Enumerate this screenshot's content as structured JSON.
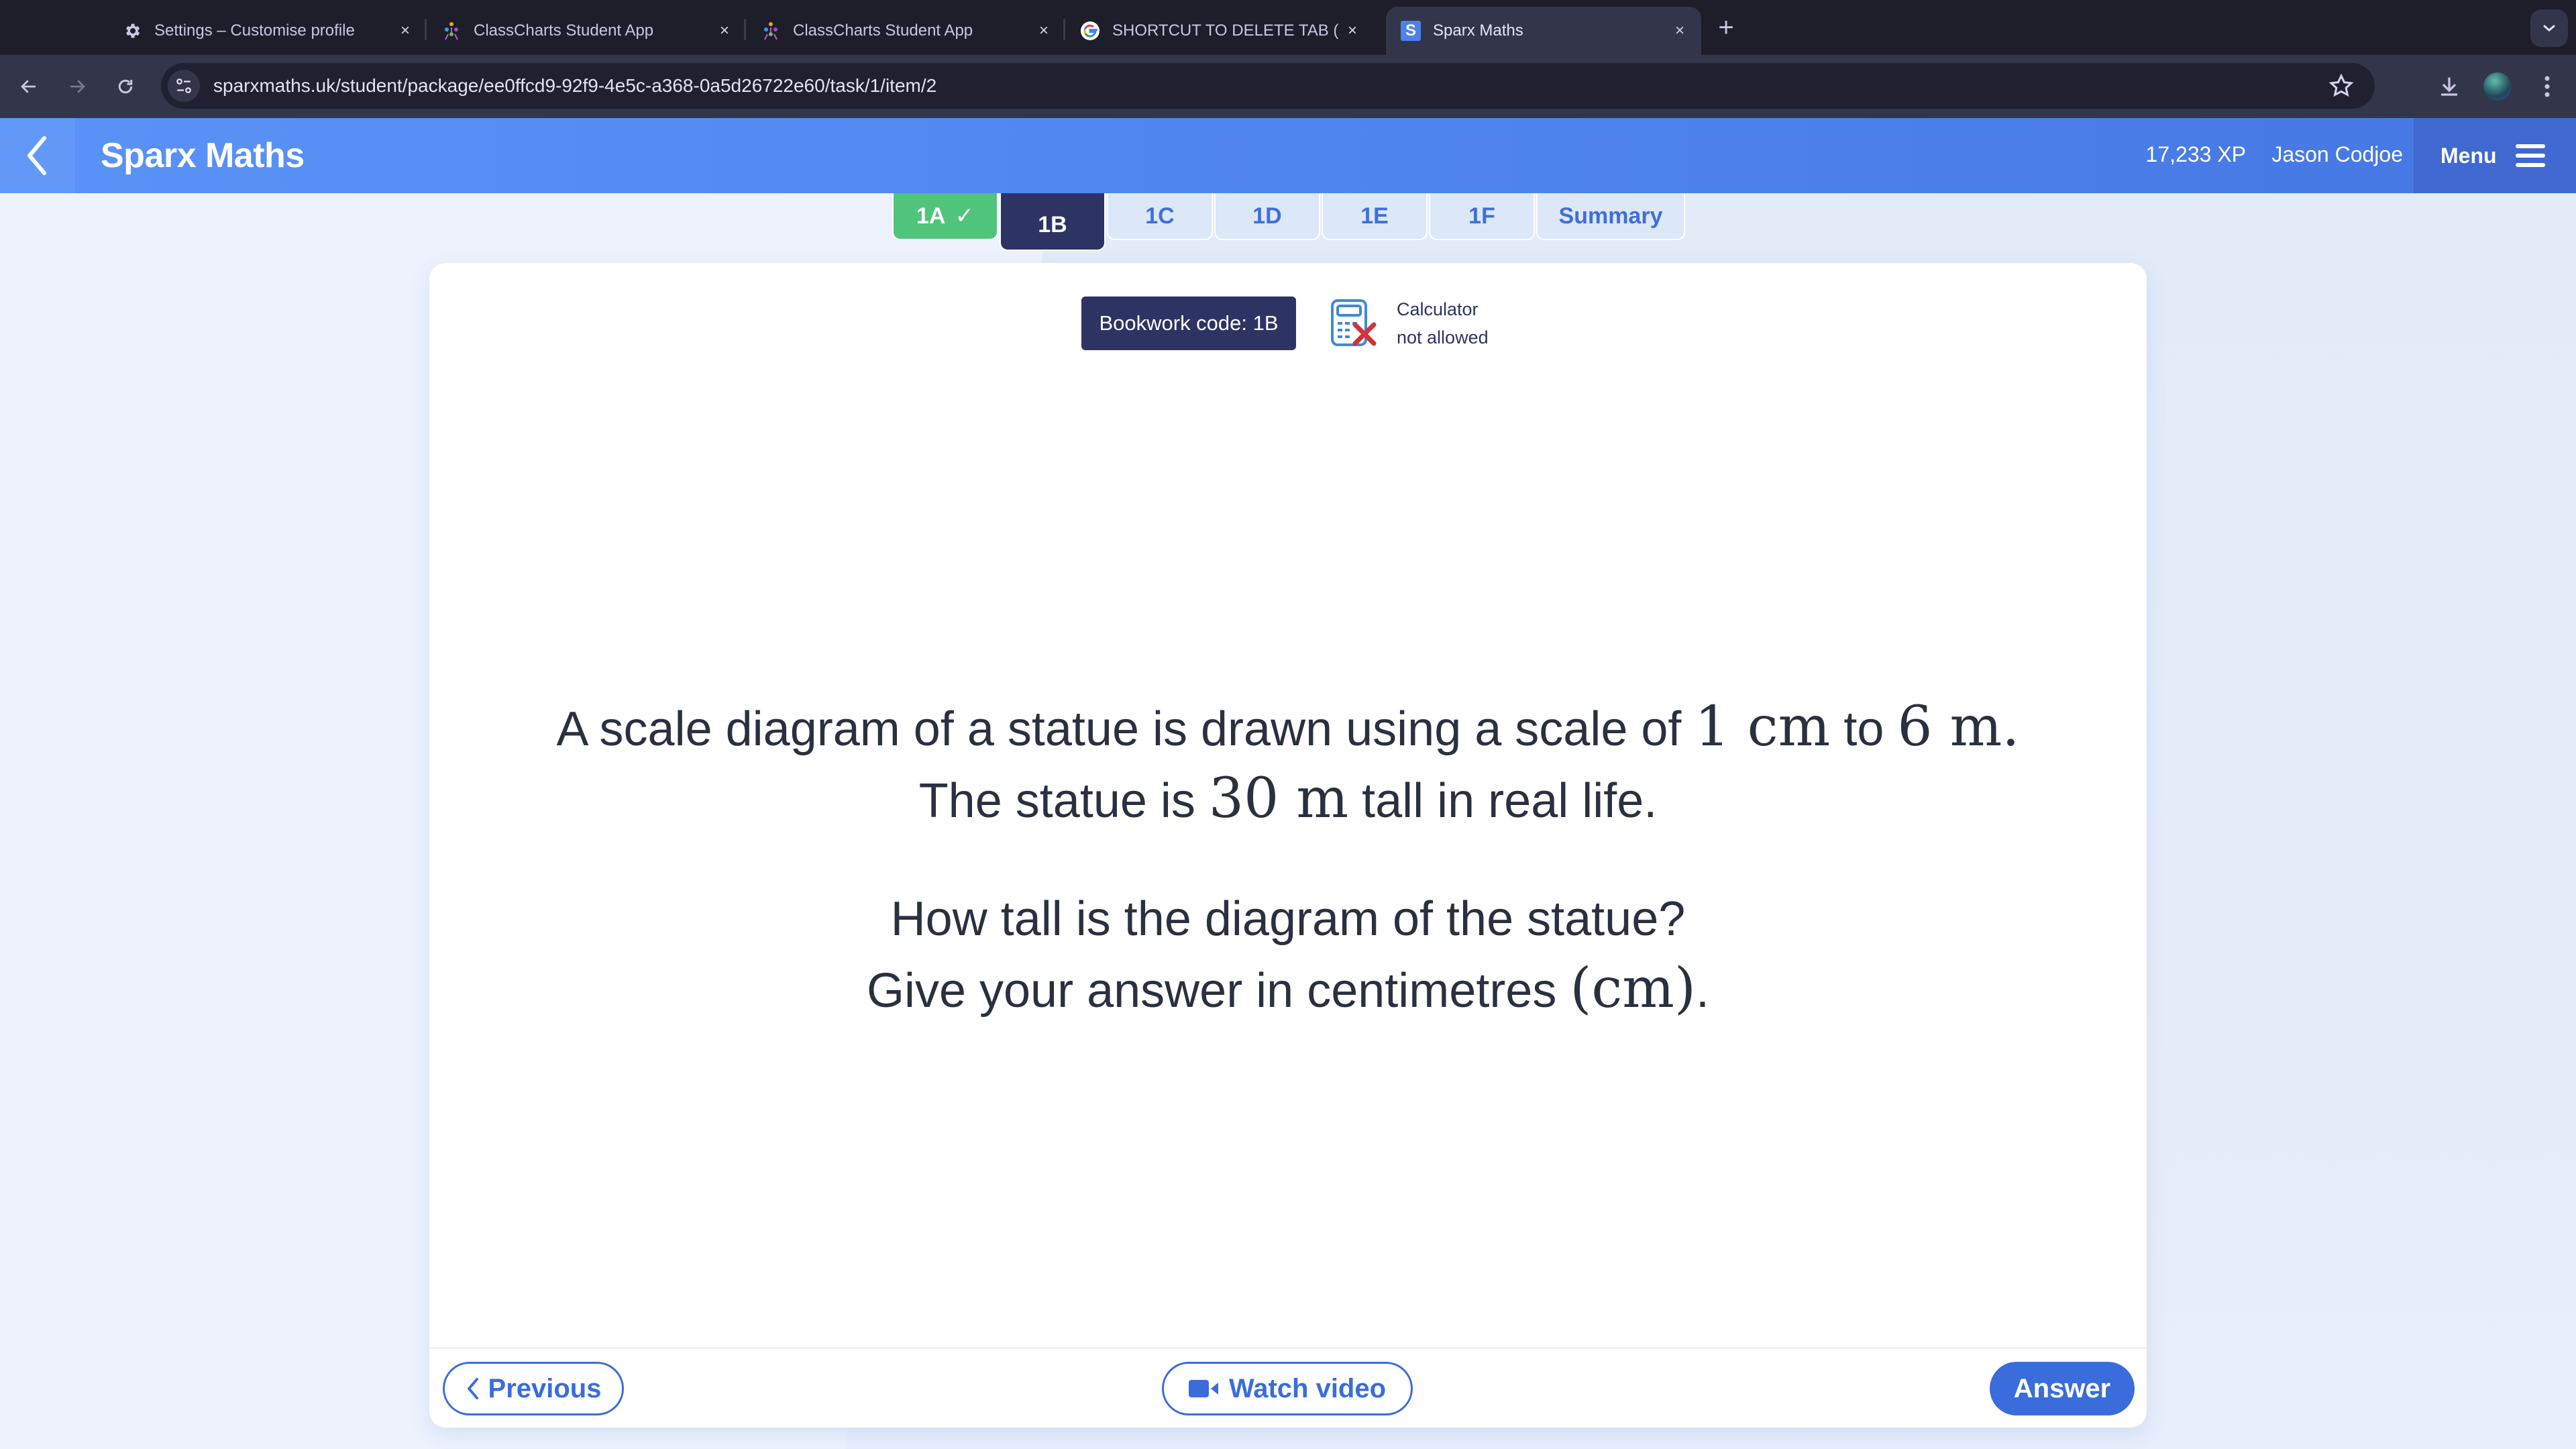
{
  "browser": {
    "tabs": [
      {
        "title": "Settings – Customise profile",
        "icon": "gear-icon",
        "active": false
      },
      {
        "title": "ClassCharts Student App",
        "icon": "classcharts-icon",
        "active": false
      },
      {
        "title": "ClassCharts Student App",
        "icon": "classcharts-icon",
        "active": false
      },
      {
        "title": "SHORTCUT TO DELETE TAB (",
        "icon": "google-icon",
        "active": false
      },
      {
        "title": "Sparx Maths",
        "icon": "sparx-icon",
        "active": true
      }
    ],
    "close_glyph": "×",
    "new_tab_glyph": "+",
    "url": "sparxmaths.uk/student/package/ee0ffcd9-92f9-4e5c-a368-0a5d26722e60/task/1/item/2",
    "sparx_favicon_letter": "S"
  },
  "header": {
    "brand": "Sparx Maths",
    "xp": "17,233 XP",
    "username": "Jason Codjoe",
    "menu_label": "Menu"
  },
  "task_tabs": [
    {
      "label": "1A",
      "state": "done",
      "check": "✓"
    },
    {
      "label": "1B",
      "state": "current"
    },
    {
      "label": "1C",
      "state": "todo"
    },
    {
      "label": "1D",
      "state": "todo"
    },
    {
      "label": "1E",
      "state": "todo"
    },
    {
      "label": "1F",
      "state": "todo"
    },
    {
      "label": "Summary",
      "state": "summary"
    }
  ],
  "card": {
    "bookwork_code": "Bookwork code: 1B",
    "calculator_line1": "Calculator",
    "calculator_line2": "not allowed",
    "question": {
      "line1_a": "A scale diagram of a statue is drawn using a scale of ",
      "line1_m1": "1 cm",
      "line1_b": " to ",
      "line1_m2": "6 m",
      "line1_c": ".",
      "line2_a": "The statue is ",
      "line2_m": "30 m",
      "line2_b": " tall in real life.",
      "line3": "How tall is the diagram of the statue?",
      "line4_a": "Give your answer in centimetres ",
      "line4_m": "(cm)",
      "line4_b": "."
    },
    "buttons": {
      "previous": "Previous",
      "watch_video": "Watch video",
      "answer": "Answer"
    }
  },
  "colors": {
    "header_blue": "#5a92f6",
    "menu_blue": "#3f69d0",
    "done_green": "#51c47b",
    "current_navy": "#2d3363",
    "accent_blue": "#3a6ddb",
    "calc_x_red": "#d0343b"
  }
}
